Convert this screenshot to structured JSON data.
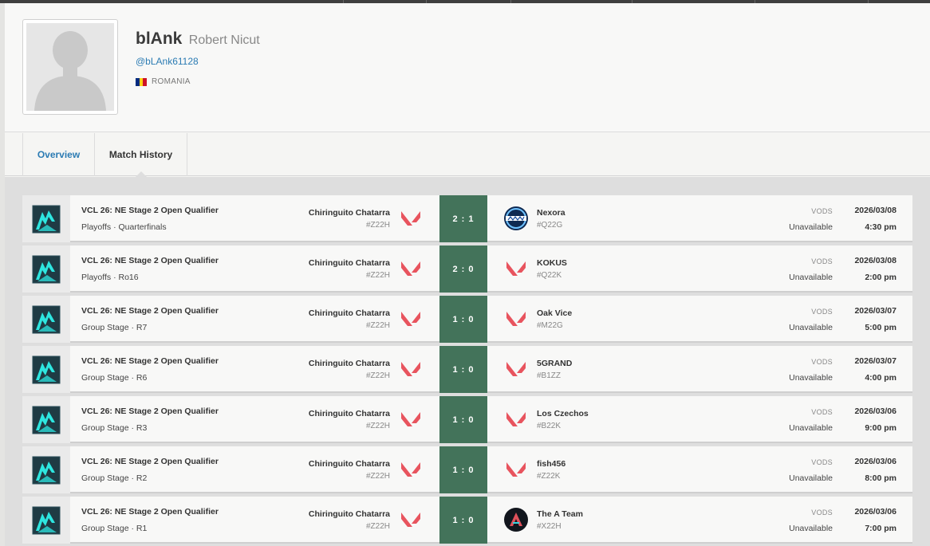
{
  "profile": {
    "handle": "blAnk",
    "real_name": "Robert Nicut",
    "user_tag": "@bLAnk61128",
    "country": "ROMANIA"
  },
  "tabs": [
    {
      "label": "Overview"
    },
    {
      "label": "Match History"
    }
  ],
  "colors": {
    "accent": "#2b7bb3",
    "score_bg": "#43735a",
    "valorant_red": "#e8545e",
    "logo_cyan": "#2ee6e0"
  },
  "matches": [
    {
      "event": "VCL 26: NE Stage 2 Open Qualifier",
      "stage": "Playoffs · Quarterfinals",
      "team1": "Chiringuito Chatarra",
      "team1_tag": "#Z22H",
      "score": "2 : 1",
      "team2": "Nexora",
      "team2_tag": "#Q22G",
      "team2_logo": "nexora-logo",
      "vods_label": "VODS",
      "vods": "Unavailable",
      "date": "2026/03/08",
      "time": "4:30 pm"
    },
    {
      "event": "VCL 26: NE Stage 2 Open Qualifier",
      "stage": "Playoffs · Ro16",
      "team1": "Chiringuito Chatarra",
      "team1_tag": "#Z22H",
      "score": "2 : 0",
      "team2": "KOKUS",
      "team2_tag": "#Q22K",
      "team2_logo": "valorant-icon",
      "vods_label": "VODS",
      "vods": "Unavailable",
      "date": "2026/03/08",
      "time": "2:00 pm"
    },
    {
      "event": "VCL 26: NE Stage 2 Open Qualifier",
      "stage": "Group Stage · R7",
      "team1": "Chiringuito Chatarra",
      "team1_tag": "#Z22H",
      "score": "1 : 0",
      "team2": "Oak Vice",
      "team2_tag": "#M22G",
      "team2_logo": "valorant-icon",
      "vods_label": "VODS",
      "vods": "Unavailable",
      "date": "2026/03/07",
      "time": "5:00 pm"
    },
    {
      "event": "VCL 26: NE Stage 2 Open Qualifier",
      "stage": "Group Stage · R6",
      "team1": "Chiringuito Chatarra",
      "team1_tag": "#Z22H",
      "score": "1 : 0",
      "team2": "5GRAND",
      "team2_tag": "#B1ZZ",
      "team2_logo": "valorant-icon",
      "vods_label": "VODS",
      "vods": "Unavailable",
      "date": "2026/03/07",
      "time": "4:00 pm"
    },
    {
      "event": "VCL 26: NE Stage 2 Open Qualifier",
      "stage": "Group Stage · R3",
      "team1": "Chiringuito Chatarra",
      "team1_tag": "#Z22H",
      "score": "1 : 0",
      "team2": "Los Czechos",
      "team2_tag": "#B22K",
      "team2_logo": "valorant-icon",
      "vods_label": "VODS",
      "vods": "Unavailable",
      "date": "2026/03/06",
      "time": "9:00 pm"
    },
    {
      "event": "VCL 26: NE Stage 2 Open Qualifier",
      "stage": "Group Stage · R2",
      "team1": "Chiringuito Chatarra",
      "team1_tag": "#Z22H",
      "score": "1 : 0",
      "team2": "fish456",
      "team2_tag": "#Z22K",
      "team2_logo": "valorant-icon",
      "vods_label": "VODS",
      "vods": "Unavailable",
      "date": "2026/03/06",
      "time": "8:00 pm"
    },
    {
      "event": "VCL 26: NE Stage 2 Open Qualifier",
      "stage": "Group Stage · R1",
      "team1": "Chiringuito Chatarra",
      "team1_tag": "#Z22H",
      "score": "1 : 0",
      "team2": "The A Team",
      "team2_tag": "#X22H",
      "team2_logo": "a-team-logo",
      "vods_label": "VODS",
      "vods": "Unavailable",
      "date": "2026/03/06",
      "time": "7:00 pm"
    }
  ]
}
